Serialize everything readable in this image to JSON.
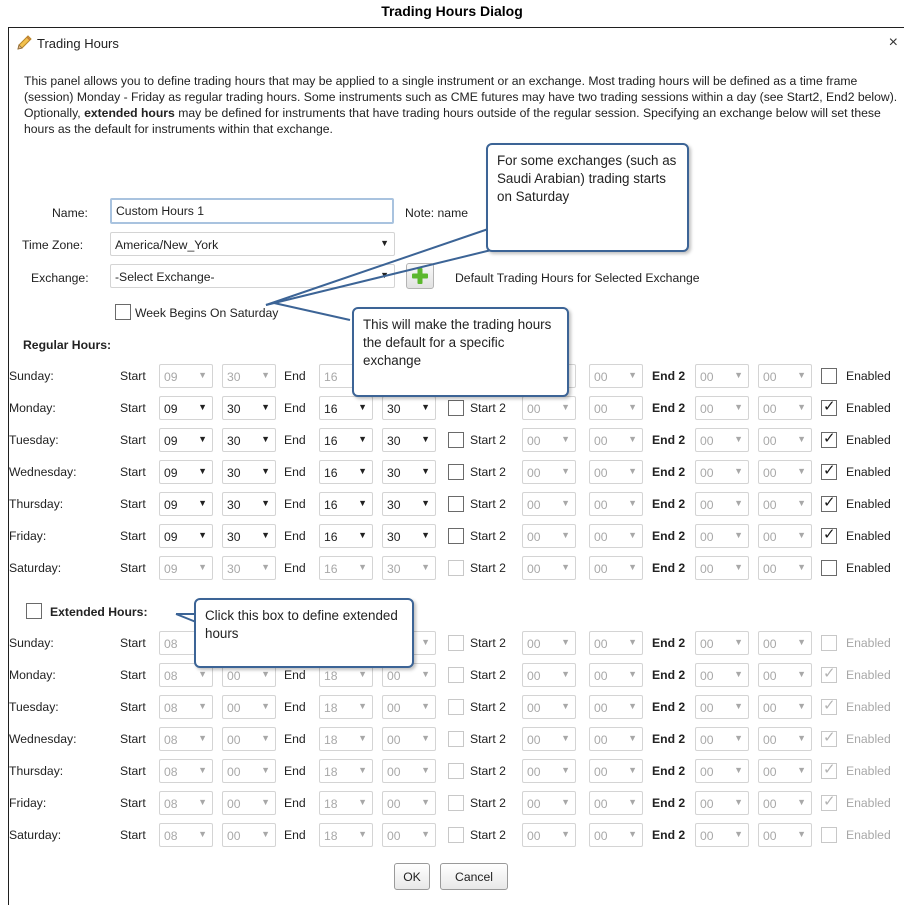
{
  "doc_title": "Trading Hours Dialog",
  "dialog": {
    "title": "Trading Hours",
    "icon": "pencil-icon",
    "close_symbol": "×",
    "description": "This panel allows you to define trading hours that may be applied to a single instrument or an exchange. Most trading hours will be defined as a time frame (session) Monday - Friday as regular trading hours. Some instruments such as CME futures may have two trading sessions within a day (see Start2, End2 below). Optionally, extended hours may be defined for instruments that have trading hours outside of the regular session. Specifying an exchange below will set these hours as the default for instruments within that exchange.",
    "desc_bold_phrase": "extended hours"
  },
  "form": {
    "name_label": "Name:",
    "name_value": "Custom Hours 1",
    "note": "Note: name",
    "timezone_label": "Time Zone:",
    "timezone_value": "America/New_York",
    "exchange_label": "Exchange:",
    "exchange_value": "-Select Exchange-",
    "default_label": "Default Trading Hours for Selected Exchange",
    "week_saturday_label": "Week Begins On Saturday",
    "week_saturday_checked": false
  },
  "labels": {
    "regular_hours": "Regular Hours:",
    "extended_hours": "Extended Hours:",
    "start": "Start",
    "end": "End",
    "start2": "Start 2",
    "end2": "End 2",
    "enabled": "Enabled",
    "arrow": "▼",
    "check": "✓"
  },
  "regular_rows": [
    {
      "day": "Sunday:",
      "start_h": "09",
      "start_m": "30",
      "end_h": "16",
      "end_m": "30",
      "s2_h": "00",
      "s2_m": "00",
      "e2_h": "00",
      "e2_m": "00",
      "enabled": false,
      "active": false
    },
    {
      "day": "Monday:",
      "start_h": "09",
      "start_m": "30",
      "end_h": "16",
      "end_m": "30",
      "s2_h": "00",
      "s2_m": "00",
      "e2_h": "00",
      "e2_m": "00",
      "enabled": true,
      "active": true
    },
    {
      "day": "Tuesday:",
      "start_h": "09",
      "start_m": "30",
      "end_h": "16",
      "end_m": "30",
      "s2_h": "00",
      "s2_m": "00",
      "e2_h": "00",
      "e2_m": "00",
      "enabled": true,
      "active": true
    },
    {
      "day": "Wednesday:",
      "start_h": "09",
      "start_m": "30",
      "end_h": "16",
      "end_m": "30",
      "s2_h": "00",
      "s2_m": "00",
      "e2_h": "00",
      "e2_m": "00",
      "enabled": true,
      "active": true
    },
    {
      "day": "Thursday:",
      "start_h": "09",
      "start_m": "30",
      "end_h": "16",
      "end_m": "30",
      "s2_h": "00",
      "s2_m": "00",
      "e2_h": "00",
      "e2_m": "00",
      "enabled": true,
      "active": true
    },
    {
      "day": "Friday:",
      "start_h": "09",
      "start_m": "30",
      "end_h": "16",
      "end_m": "30",
      "s2_h": "00",
      "s2_m": "00",
      "e2_h": "00",
      "e2_m": "00",
      "enabled": true,
      "active": true
    },
    {
      "day": "Saturday:",
      "start_h": "09",
      "start_m": "30",
      "end_h": "16",
      "end_m": "30",
      "s2_h": "00",
      "s2_m": "00",
      "e2_h": "00",
      "e2_m": "00",
      "enabled": false,
      "active": false
    }
  ],
  "extended_rows": [
    {
      "day": "Sunday:",
      "start_h": "08",
      "start_m": "00",
      "end_h": "18",
      "end_m": "00",
      "s2_h": "00",
      "s2_m": "00",
      "e2_h": "00",
      "e2_m": "00",
      "enabled": false
    },
    {
      "day": "Monday:",
      "start_h": "08",
      "start_m": "00",
      "end_h": "18",
      "end_m": "00",
      "s2_h": "00",
      "s2_m": "00",
      "e2_h": "00",
      "e2_m": "00",
      "enabled": true
    },
    {
      "day": "Tuesday:",
      "start_h": "08",
      "start_m": "00",
      "end_h": "18",
      "end_m": "00",
      "s2_h": "00",
      "s2_m": "00",
      "e2_h": "00",
      "e2_m": "00",
      "enabled": true
    },
    {
      "day": "Wednesday:",
      "start_h": "08",
      "start_m": "00",
      "end_h": "18",
      "end_m": "00",
      "s2_h": "00",
      "s2_m": "00",
      "e2_h": "00",
      "e2_m": "00",
      "enabled": true
    },
    {
      "day": "Thursday:",
      "start_h": "08",
      "start_m": "00",
      "end_h": "18",
      "end_m": "00",
      "s2_h": "00",
      "s2_m": "00",
      "e2_h": "00",
      "e2_m": "00",
      "enabled": true
    },
    {
      "day": "Friday:",
      "start_h": "08",
      "start_m": "00",
      "end_h": "18",
      "end_m": "00",
      "s2_h": "00",
      "s2_m": "00",
      "e2_h": "00",
      "e2_m": "00",
      "enabled": true
    },
    {
      "day": "Saturday:",
      "start_h": "08",
      "start_m": "00",
      "end_h": "18",
      "end_m": "00",
      "s2_h": "00",
      "s2_m": "00",
      "e2_h": "00",
      "e2_m": "00",
      "enabled": false
    }
  ],
  "extended_checked": false,
  "buttons": {
    "ok": "OK",
    "cancel": "Cancel"
  },
  "callouts": {
    "saturday": "For some exchanges (such as Saudi Arabian) trading starts on Saturday",
    "default": "This will make the trading hours the default for a specific exchange",
    "extended": "Click this box to define extended hours"
  },
  "colors": {
    "callout_border": "#3c6496",
    "add_icon": "#5cb82e",
    "input_focus": "#a9c3df"
  }
}
